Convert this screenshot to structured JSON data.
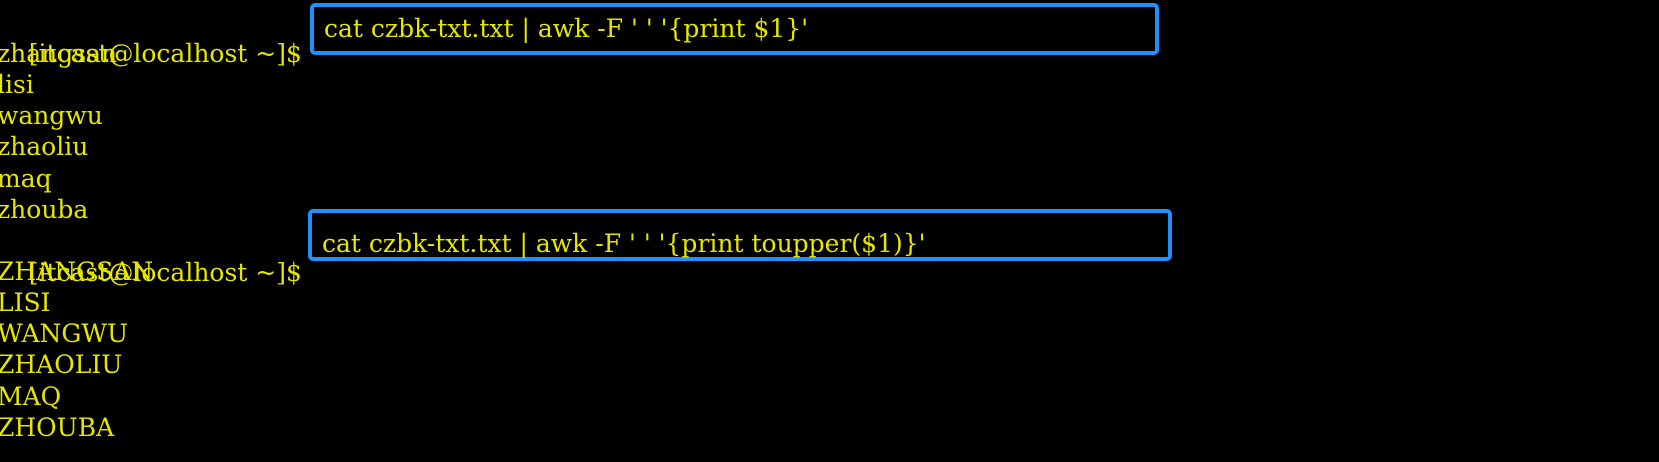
{
  "terminal": {
    "text_color": "#e6e600",
    "background": "#000000",
    "highlight_color": "#1e90ff",
    "prompt1": "[itcast@localhost ~]$",
    "command1": "cat czbk-txt.txt | awk -F ' ' '{print $1}'",
    "output1": [
      "zhangsan",
      "lisi",
      "wangwu",
      "zhaoliu",
      "maq",
      "zhouba"
    ],
    "prompt2": "[itcast@localhost ~]$",
    "command2": "cat czbk-txt.txt | awk -F ' ' '{print toupper($1)}'",
    "output2": [
      "ZHANGSAN",
      "LISI",
      "WANGWU",
      "ZHAOLIU",
      "MAQ",
      "ZHOUBA"
    ]
  }
}
